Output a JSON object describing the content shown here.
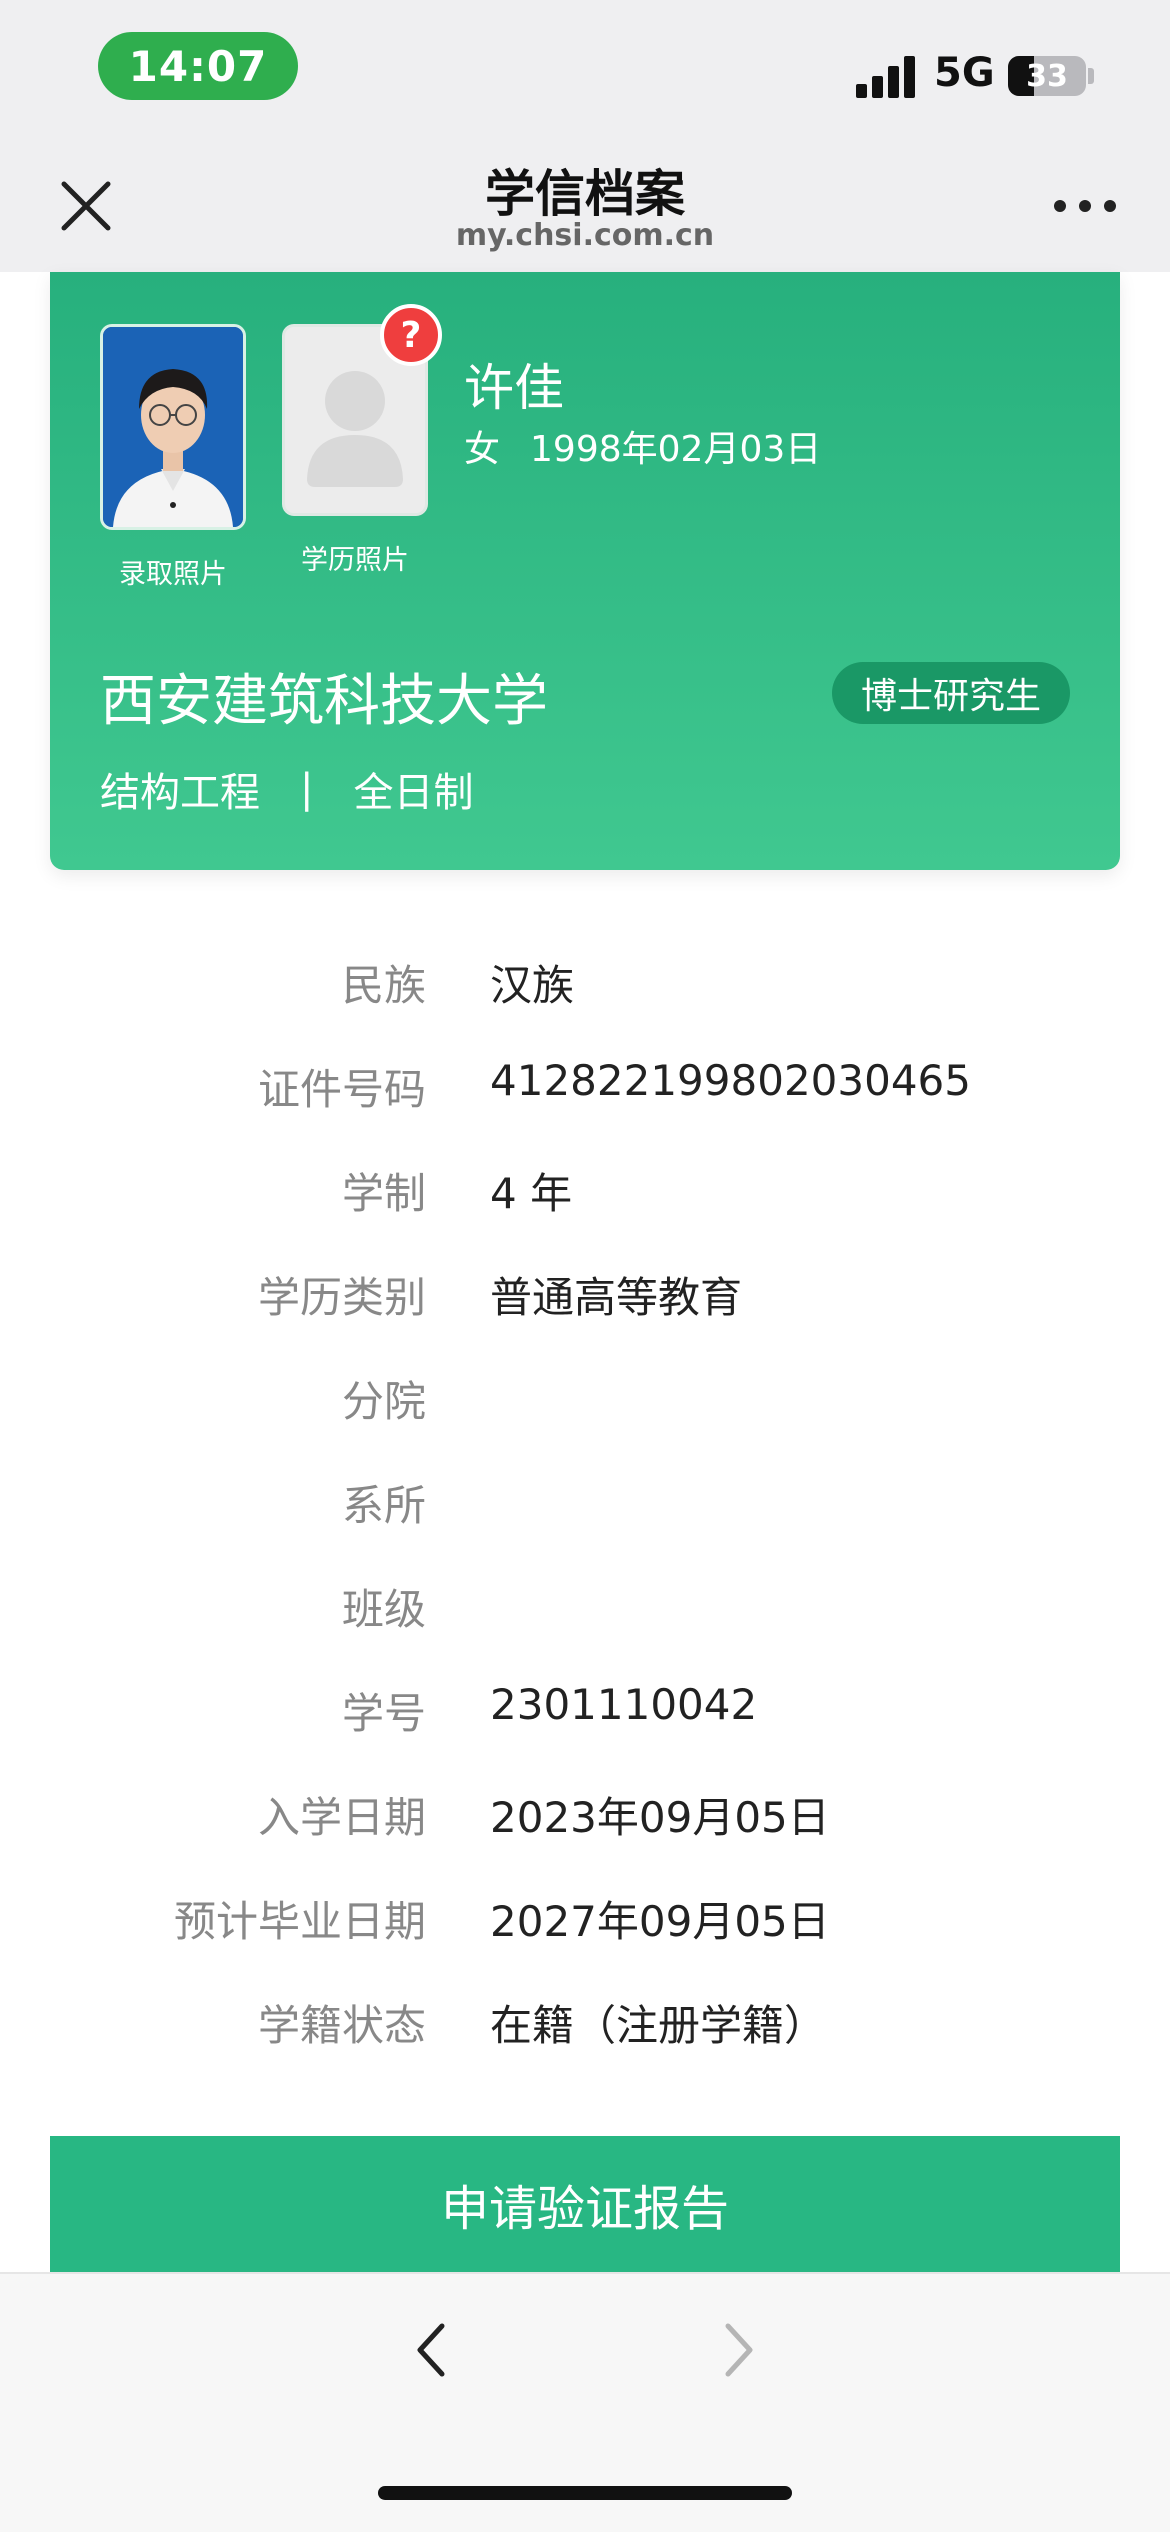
{
  "status_bar": {
    "time": "14:07",
    "network": "5G",
    "battery_level": "33",
    "battery_fraction": 0.33
  },
  "nav": {
    "title": "学信档案",
    "url": "my.chsi.com.cn"
  },
  "card": {
    "photo_caption_admission": "录取照片",
    "photo_caption_degree": "学历照片",
    "question_badge": "?",
    "name": "许佳",
    "gender": "女",
    "birth_date": "1998年02月03日",
    "university": "西安建筑科技大学",
    "degree_level": "博士研究生",
    "major": "结构工程",
    "separator": "|",
    "study_mode": "全日制",
    "accent_color": "#27b07d"
  },
  "info_rows": [
    {
      "label": "民族",
      "value": "汉族"
    },
    {
      "label": "证件号码",
      "value": "412822199802030465"
    },
    {
      "label": "学制",
      "value": "4 年"
    },
    {
      "label": "学历类别",
      "value": "普通高等教育"
    },
    {
      "label": "分院",
      "value": ""
    },
    {
      "label": "系所",
      "value": ""
    },
    {
      "label": "班级",
      "value": ""
    },
    {
      "label": "学号",
      "value": "2301110042"
    },
    {
      "label": "入学日期",
      "value": "2023年09月05日"
    },
    {
      "label": "预计毕业日期",
      "value": "2027年09月05日"
    },
    {
      "label": "学籍状态",
      "value": "在籍（注册学籍）"
    }
  ],
  "actions": {
    "apply_label": "申请验证报告"
  },
  "icons": {
    "close": "close-icon",
    "more": "more-icon",
    "back": "chevron-left-icon",
    "forward": "chevron-right-icon"
  }
}
